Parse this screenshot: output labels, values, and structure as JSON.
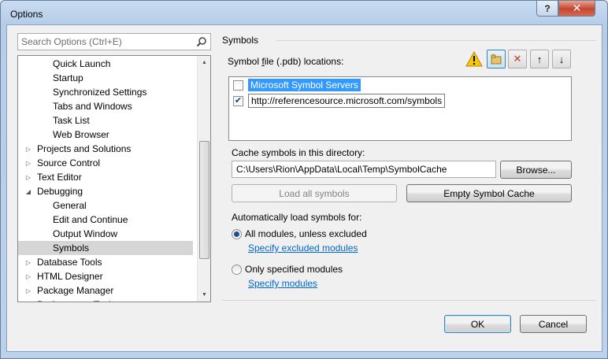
{
  "window": {
    "title": "Options",
    "help_glyph": "?",
    "close_glyph": "✕"
  },
  "search": {
    "placeholder": "Search Options (Ctrl+E)"
  },
  "tree": {
    "items": [
      {
        "label": "Quick Launch",
        "indent": 2,
        "expander": ""
      },
      {
        "label": "Startup",
        "indent": 2,
        "expander": ""
      },
      {
        "label": "Synchronized Settings",
        "indent": 2,
        "expander": ""
      },
      {
        "label": "Tabs and Windows",
        "indent": 2,
        "expander": ""
      },
      {
        "label": "Task List",
        "indent": 2,
        "expander": ""
      },
      {
        "label": "Web Browser",
        "indent": 2,
        "expander": ""
      },
      {
        "label": "Projects and Solutions",
        "indent": 1,
        "expander": "▷"
      },
      {
        "label": "Source Control",
        "indent": 1,
        "expander": "▷"
      },
      {
        "label": "Text Editor",
        "indent": 1,
        "expander": "▷"
      },
      {
        "label": "Debugging",
        "indent": 1,
        "expander": "◢"
      },
      {
        "label": "General",
        "indent": 2,
        "expander": ""
      },
      {
        "label": "Edit and Continue",
        "indent": 2,
        "expander": ""
      },
      {
        "label": "Output Window",
        "indent": 2,
        "expander": ""
      },
      {
        "label": "Symbols",
        "indent": 2,
        "expander": "",
        "selected": true
      },
      {
        "label": "Database Tools",
        "indent": 1,
        "expander": "▷"
      },
      {
        "label": "HTML Designer",
        "indent": 1,
        "expander": "▷"
      },
      {
        "label": "Package Manager",
        "indent": 1,
        "expander": "▷"
      },
      {
        "label": "Performance Tools",
        "indent": 1,
        "expander": "▷"
      }
    ]
  },
  "symbols": {
    "section_title": "Symbols",
    "locations_label_pre": "Symbol ",
    "locations_label_u": "f",
    "locations_label_post": "ile (.pdb) locations:",
    "locations": [
      {
        "text": "Microsoft Symbol Servers",
        "checked": false
      },
      {
        "text": "http://referencesource.microsoft.com/symbols",
        "checked": true
      }
    ],
    "cache_label": "Cache symbols in this directory:",
    "cache_path": "C:\\Users\\Rion\\AppData\\Local\\Temp\\SymbolCache",
    "browse_label": "Browse...",
    "load_all_label": "Load all symbols",
    "empty_cache_label": "Empty Symbol Cache",
    "auto_load_label": "Automatically load symbols for:",
    "option_all": "All modules, unless excluded",
    "option_all_link": "Specify excluded modules",
    "option_only": "Only specified modules",
    "option_only_link": "Specify modules"
  },
  "footer": {
    "ok_label": "OK",
    "cancel_label": "Cancel"
  },
  "colors": {
    "selection": "#3399ff",
    "link": "#0066cc",
    "tree_selected": "#d6d6d6"
  }
}
